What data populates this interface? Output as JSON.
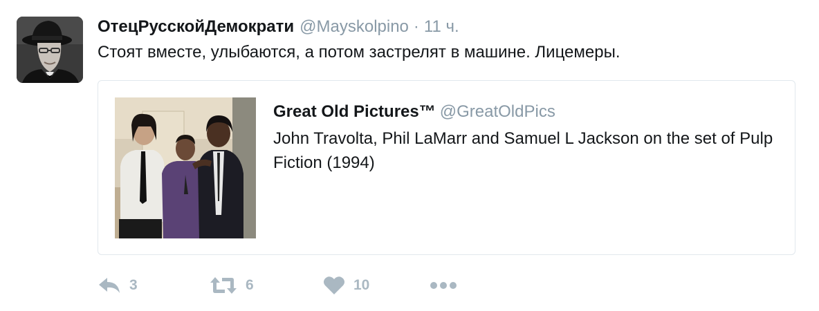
{
  "tweet": {
    "author_name": "ОтецРусскойДемократи",
    "author_handle": "@Mayskolpino",
    "separator": "·",
    "time": "11 ч.",
    "text": "Стоят вместе, улыбаются, а потом застрелят в машине. Лицемеры."
  },
  "quoted": {
    "author_name": "Great Old Pictures™",
    "author_handle": "@GreatOldPics",
    "text": "John Travolta, Phil LaMarr and Samuel L Jackson on the set of Pulp Fiction (1994)"
  },
  "actions": {
    "reply_count": "3",
    "retweet_count": "6",
    "like_count": "10"
  },
  "colors": {
    "secondary_text": "#8899a6",
    "action_icon": "#aab8c2",
    "card_border": "#e1e8ed"
  },
  "icons": {
    "reply": "reply-icon",
    "retweet": "retweet-icon",
    "like": "heart-icon",
    "more": "more-dots-icon"
  }
}
